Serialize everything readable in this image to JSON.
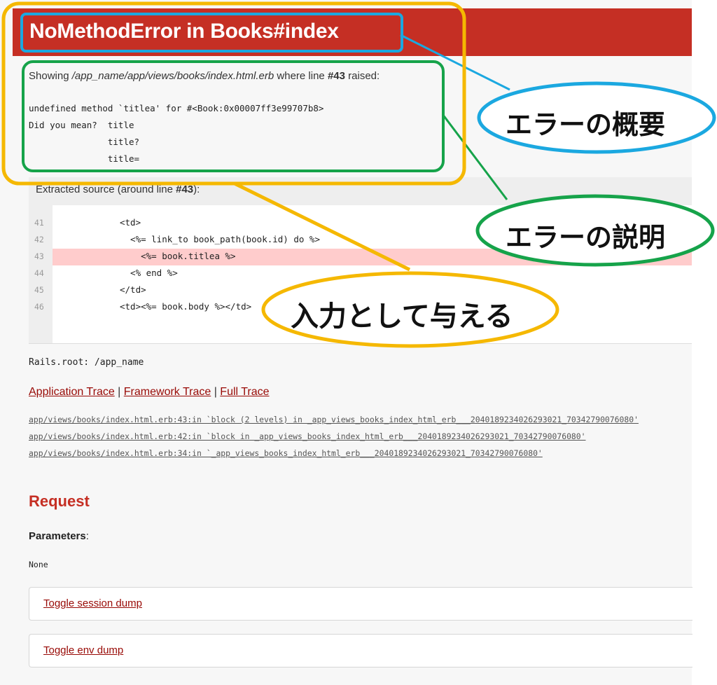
{
  "header": {
    "title": "NoMethodError in Books#index"
  },
  "showing": {
    "prefix": "Showing ",
    "path": "/app_name/app/views/books/index.html.erb",
    "middle": " where line ",
    "line": "#43",
    "suffix": " raised:"
  },
  "error_message": {
    "lines": [
      "undefined method `titlea' for #<Book:0x00007ff3e99707b8>",
      "Did you mean?  title",
      "               title?",
      "               title="
    ]
  },
  "source": {
    "title_prefix": "Extracted source (around line ",
    "title_line": "#43",
    "title_suffix": "):",
    "lines": [
      {
        "num": "41",
        "code": "<td>"
      },
      {
        "num": "42",
        "code": "  <%= link_to book_path(book.id) do %>"
      },
      {
        "num": "43",
        "code": "    <%= book.titlea %>"
      },
      {
        "num": "44",
        "code": "  <% end %>"
      },
      {
        "num": "45",
        "code": "</td>"
      },
      {
        "num": "46",
        "code": "<td><%= book.body %></td>"
      }
    ]
  },
  "rails_root": "Rails.root: /app_name",
  "trace_tabs": {
    "application": "Application Trace",
    "sep1": " | ",
    "framework": "Framework Trace",
    "sep2": " | ",
    "full": "Full Trace"
  },
  "trace_lines": [
    "app/views/books/index.html.erb:43:in `block (2 levels) in _app_views_books_index_html_erb___2040189234026293021_70342790076080'",
    "app/views/books/index.html.erb:42:in `block in _app_views_books_index_html_erb___2040189234026293021_70342790076080'",
    "app/views/books/index.html.erb:34:in `_app_views_books_index_html_erb___2040189234026293021_70342790076080'"
  ],
  "request": {
    "heading": "Request",
    "params_label": "Parameters",
    "params_colon": ":",
    "params_value": "None"
  },
  "dumps": {
    "session": "Toggle session dump",
    "env": "Toggle env dump"
  },
  "annotations": {
    "summary": "エラーの概要",
    "description": "エラーの説明",
    "input": "入力として与える"
  },
  "colors": {
    "header_red": "#c52f24",
    "link_red": "#980905",
    "highlight": "#ffcccc",
    "annotation_blue": "#1ba8e0",
    "annotation_green": "#16a34a",
    "annotation_yellow": "#f5b800"
  }
}
